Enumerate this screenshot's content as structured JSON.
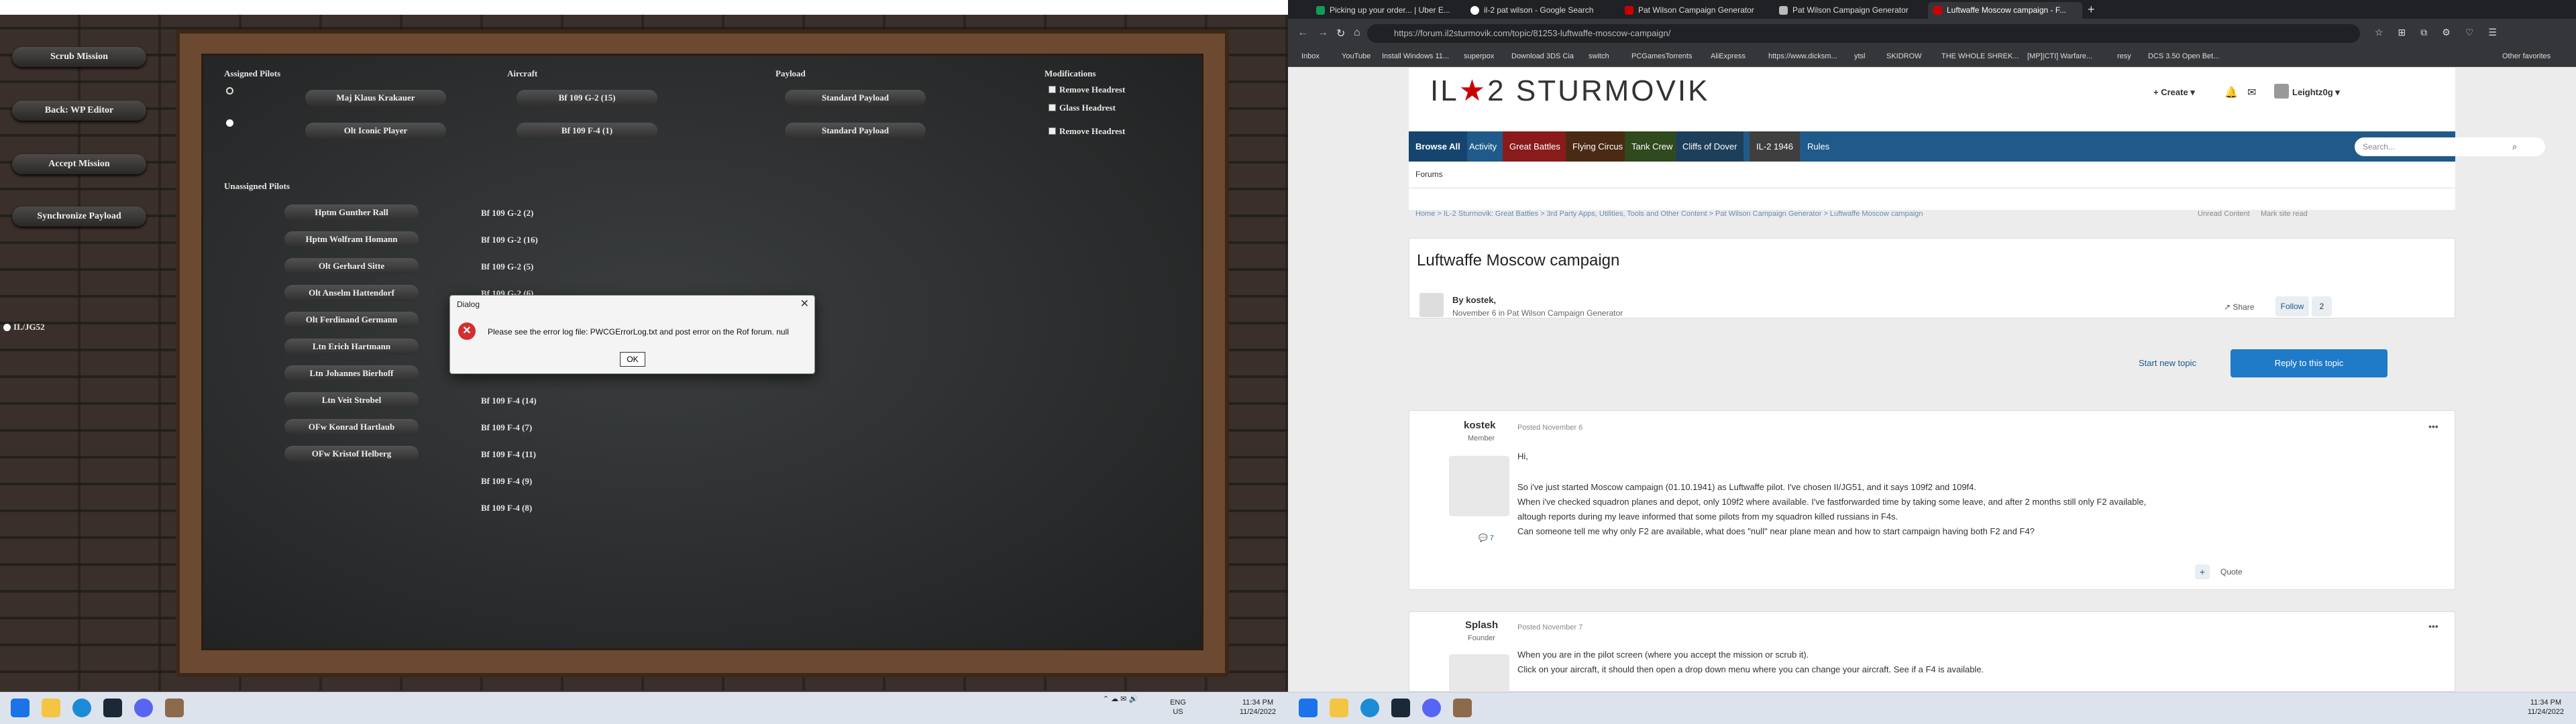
{
  "pwcg": {
    "side_buttons": [
      "Scrub Mission",
      "Back: WP Editor",
      "Accept Mission",
      "Synchronize Payload"
    ],
    "group": "II./JG52",
    "headers": {
      "assigned": "Assigned Pilots",
      "aircraft": "Aircraft",
      "payload": "Payload",
      "mods": "Modifications",
      "unassigned": "Unassigned Pilots"
    },
    "assigned": [
      {
        "pilot": "Maj Klaus Krakauer",
        "aircraft": "Bf 109 G-2 (15)",
        "payload": "Standard Payload",
        "mods": [
          "Remove Headrest",
          "Glass Headrest"
        ]
      },
      {
        "pilot": "Olt Iconic Player",
        "aircraft": "Bf 109 F-4 (1)",
        "payload": "Standard Payload",
        "mods": [
          "Remove Headrest"
        ]
      }
    ],
    "unassigned_pilots": [
      "Hptm Gunther Rall",
      "Hptm Wolfram Homann",
      "Olt Gerhard Sitte",
      "Olt Anselm Hattendorf",
      "Olt Ferdinand Germann",
      "Ltn Erich Hartmann",
      "Ltn Johannes Bierhoff",
      "Ltn Veit Strobel",
      "OFw Konrad Hartlaub",
      "OFw Kristof Helberg"
    ],
    "unassigned_aircraft": [
      "Bf 109 G-2 (2)",
      "Bf 109 G-2 (16)",
      "Bf 109 G-2 (5)",
      "Bf 109 G-2 (6)",
      "",
      "",
      "",
      "Bf 109 F-4 (14)",
      "Bf 109 F-4 (7)",
      "Bf 109 F-4 (11)",
      "Bf 109 F-4 (9)",
      "Bf 109 F-4 (8)"
    ]
  },
  "dialog": {
    "title": "Dialog",
    "message": "Please see the error log file: PWCGErrorLog.txt and post error on the Rof forum.  null",
    "ok": "OK"
  },
  "taskbar_left": {
    "lang": "ENG",
    "region": "US",
    "time": "11:34 PM",
    "date": "11/24/2022"
  },
  "taskbar_right": {
    "time": "11:34 PM",
    "date": "11/24/2022"
  },
  "browser": {
    "tabs": [
      "Picking up your order... | Uber E...",
      "il-2 pat wilson - Google Search",
      "Pat Wilson Campaign Generator",
      "Pat Wilson Campaign Generator",
      "Luftwaffe Moscow campaign - F..."
    ],
    "url": "https://forum.il2sturmovik.com/topic/81253-luftwaffe-moscow-campaign/",
    "bookmarks": [
      "Inbox",
      "YouTube",
      "Install Windows 11...",
      "superpox",
      "Download 3DS Cia",
      "switch",
      "PCGamesTorrents",
      "AliExpress",
      "https://www.dicksm...",
      "ytsl",
      "SKIDROW",
      "THE WHOLE SHREK...",
      "[MP]|CTI] Warfare...",
      "resy",
      "DCS 3.50 Open Bet...",
      "Other favorites"
    ],
    "site_title_a": "IL",
    "site_title_b": "2 STURMOVIK",
    "create": "Create",
    "user": "Leightz0g",
    "nav": [
      "Browse All",
      "Activity",
      "Great Battles",
      "Flying Circus",
      "Tank Crew",
      "Cliffs of Dover",
      "IL-2 1946",
      "Rules"
    ],
    "search_placeholder": "Search...",
    "forums": "Forums",
    "breadcrumbs": "Home  >  IL-2 Sturmovik: Great Battles  >  3rd Party Apps, Utilities, Tools and Other Content  >  Pat Wilson Campaign Generator  >  Luftwaffe Moscow campaign",
    "unread": "Unread Content",
    "mark_read": "Mark site read",
    "topic_title": "Luftwaffe Moscow campaign",
    "by": "By kostek,",
    "by_sub": "November 6 in Pat Wilson Campaign Generator",
    "share": "Share",
    "follow": "Follow",
    "follow_count": "2",
    "start_topic": "Start new topic",
    "reply": "Reply to this topic",
    "posts": [
      {
        "author": "kostek",
        "role": "Member",
        "date": "Posted November 6",
        "count": "7",
        "lines": [
          "Hi,",
          "",
          "So i've just started Moscow campaign (01.10.1941) as Luftwaffe pilot. I've chosen II/JG51, and it says 109f2 and 109f4.",
          "When i've checked squadron planes and depot, only 109f2 where available. I've fastforwarded time by taking some leave, and after 2 months still only F2 available,",
          "altough reports during my leave informed that some pilots from my squadron killed russians in F4s.",
          "Can someone tell me why only F2 are available, what does \"null\" near plane mean and how to start campaign having both F2 and F4?"
        ],
        "quote": "Quote"
      },
      {
        "author": "Splash",
        "role": "Founder",
        "date": "Posted November 7",
        "lines": [
          "When you are in the pilot screen (where you accept the mission or scrub it).",
          "Click on your aircraft, it should then open a drop down menu where you can change your aircraft.  See if a F4 is available."
        ]
      }
    ]
  }
}
